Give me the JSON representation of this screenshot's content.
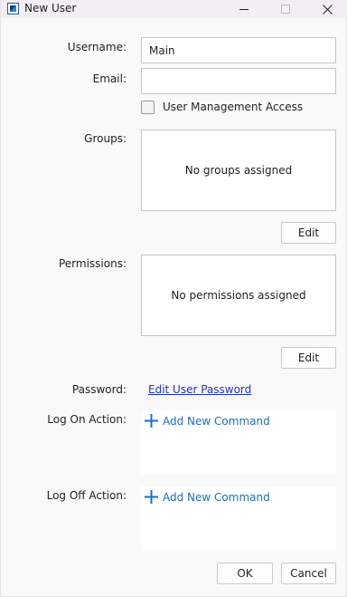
{
  "window": {
    "title": "New User"
  },
  "form": {
    "username_label": "Username:",
    "username_value": "Main",
    "email_label": "Email:",
    "email_value": "",
    "user_management_access_label": "User Management Access",
    "user_management_access_checked": false,
    "groups_label": "Groups:",
    "groups_empty_text": "No groups assigned",
    "groups_edit_label": "Edit",
    "permissions_label": "Permissions:",
    "permissions_empty_text": "No permissions assigned",
    "permissions_edit_label": "Edit",
    "password_label": "Password:",
    "password_link": "Edit User Password",
    "logon_label": "Log On Action:",
    "logon_add_command": "Add New Command",
    "logoff_label": "Log Off Action:",
    "logoff_add_command": "Add New Command"
  },
  "footer": {
    "ok_label": "OK",
    "cancel_label": "Cancel"
  },
  "icons": {
    "app": "app-icon",
    "minimize": "minimize-icon",
    "maximize": "maximize-icon",
    "close": "close-icon",
    "add": "plus-icon"
  },
  "colors": {
    "titlebar": "#f3eef1",
    "link": "#1a32d6",
    "accent": "#1a6fc4"
  }
}
